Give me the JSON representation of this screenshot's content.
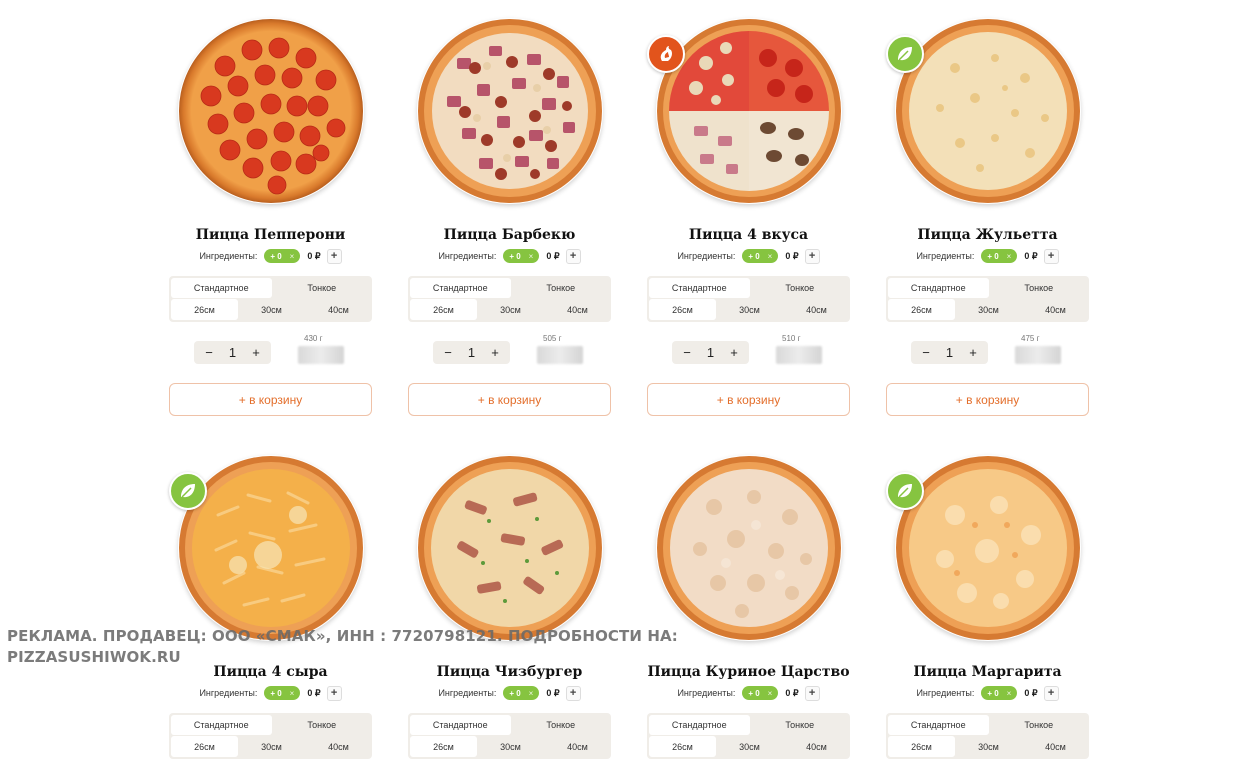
{
  "labels": {
    "ingredients": "Ингредиенты:",
    "ingredients_pill": "+ 0",
    "ingredients_remove": "×",
    "ingredients_price": "0 ₽",
    "add_ingredient": "+",
    "dough_standard": "Стандартное",
    "dough_thin": "Тонкое",
    "size_26": "26см",
    "size_30": "30см",
    "size_40": "40см",
    "qty_minus": "−",
    "qty_plus": "+",
    "add_to_cart": "+ в корзину"
  },
  "products": [
    {
      "name": "Пицца Пепперони",
      "badge": "",
      "quantity": "1",
      "weight": "430 г",
      "selected_dough": "Стандартное",
      "selected_size": "26см"
    },
    {
      "name": "Пицца Барбекю",
      "badge": "",
      "quantity": "1",
      "weight": "505 г",
      "selected_dough": "Стандартное",
      "selected_size": "26см"
    },
    {
      "name": "Пицца 4 вкуса",
      "badge": "spicy-icon",
      "quantity": "1",
      "weight": "510 г",
      "selected_dough": "Стандартное",
      "selected_size": "26см"
    },
    {
      "name": "Пицца Жульетта",
      "badge": "leaf-icon",
      "quantity": "1",
      "weight": "475 г",
      "selected_dough": "Стандартное",
      "selected_size": "26см"
    },
    {
      "name": "Пицца 4 сыра",
      "badge": "leaf-icon",
      "selected_dough": "Стандартное",
      "selected_size": "26см"
    },
    {
      "name": "Пицца Чизбургер",
      "badge": "",
      "selected_dough": "Стандартное",
      "selected_size": "26см"
    },
    {
      "name": "Пицца Куриное Царство",
      "badge": "",
      "selected_dough": "Стандартное",
      "selected_size": "26см"
    },
    {
      "name": "Пицца Маргарита",
      "badge": "leaf-icon",
      "selected_dough": "Стандартное",
      "selected_size": "26см"
    }
  ],
  "ad_notice": {
    "line1": "РЕКЛАМА.  ПРОДАВЕЦ: ООО «СМАК»,  ИНН : 7720798121. ПОДРОБНОСТИ НА:",
    "line2": "PIZZASUSHIWOK.RU"
  },
  "colors": {
    "accent_green": "#86c440",
    "accent_orange": "#e36e2b",
    "spicy_badge": "#e2541c",
    "option_bg": "#f0ede8"
  }
}
